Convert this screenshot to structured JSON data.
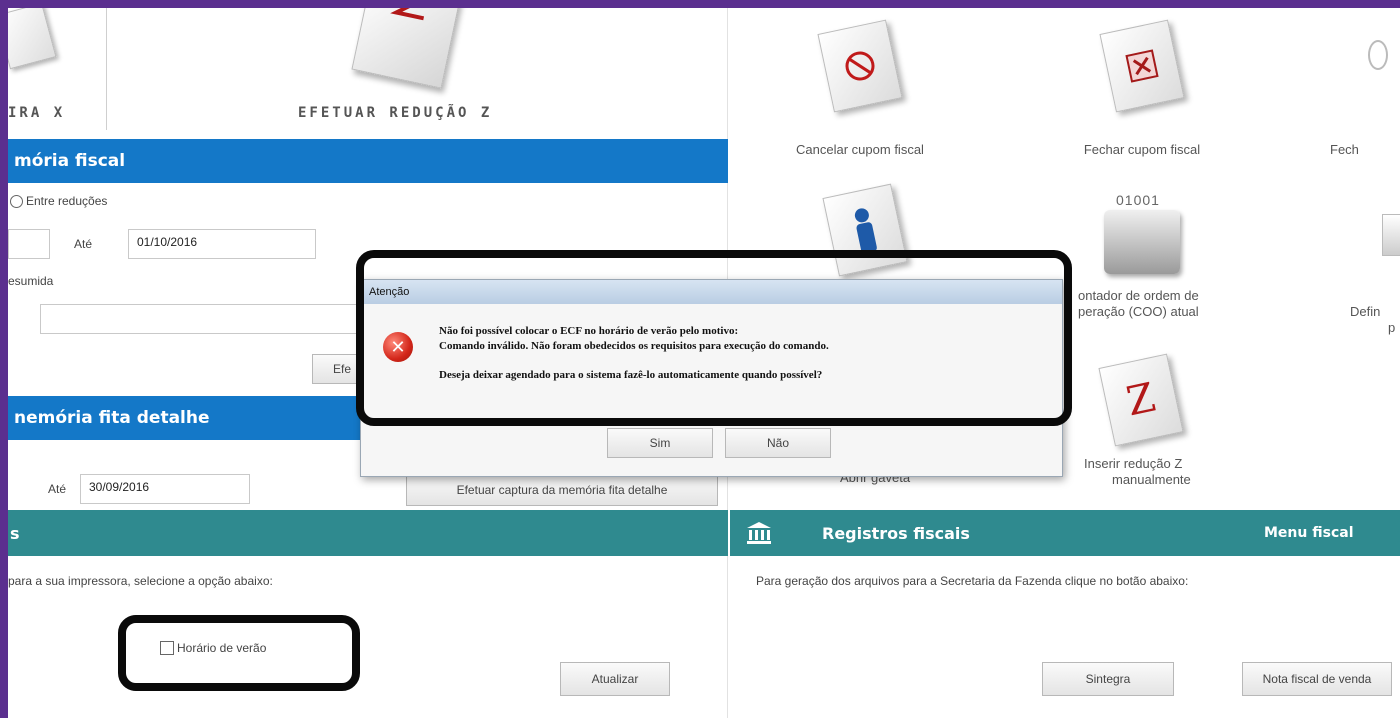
{
  "left": {
    "leitura_x_label": "IRA X",
    "reducao_z_label": "EFETUAR REDUÇÃO Z",
    "memoria_fiscal": {
      "header": "mória fiscal",
      "radio_label": "Entre reduções",
      "ate_label": "Até",
      "ate_value": "01/10/2016",
      "resumida_label": "esumida",
      "button_label": "Efe"
    },
    "memoria_fita": {
      "header": "nemória fita detalhe",
      "ate_label": "Até",
      "ate_value": "30/09/2016",
      "button_label": "Efetuar captura da memória fita detalhe"
    },
    "impressora": {
      "header": "s",
      "description": "para a sua impressora, selecione a opção abaixo:",
      "checkbox_label": "Horário de verão",
      "update_button": "Atualizar"
    }
  },
  "right": {
    "cards": [
      {
        "label": "Cancelar cupom fiscal",
        "icon": "cancel-icon"
      },
      {
        "label": "Fechar cupom fiscal",
        "icon": "close-receipt-icon"
      },
      {
        "label": "Fech",
        "icon": "partial-icon"
      }
    ],
    "row2": {
      "coo_number": "01001",
      "coo_label_line1": "ontador de ordem de",
      "coo_label_line2": "peração (COO) atual",
      "right_label_line1": "Defin",
      "right_label_line2": "p"
    },
    "row3": {
      "z_glyph": "Z",
      "z_label_line1": "Inserir redução Z",
      "z_label_line2": "manualmente",
      "gaveta_label": "Abrir gaveta"
    },
    "registros": {
      "header": "Registros fiscais",
      "menu_label": "Menu fiscal",
      "description": "Para geração dos arquivos para a Secretaria da Fazenda clique no botão abaixo:",
      "sintegra_button": "Sintegra",
      "nota_button": "Nota fiscal de venda"
    }
  },
  "dialog": {
    "title": "Atenção",
    "line1": "Não foi possível colocar o ECF no horário de verão pelo motivo:",
    "line2": "Comando inválido. Não foram obedecidos os requisitos para execução do comando.",
    "line3": "Deseja deixar agendado para o sistema fazê-lo automaticamente quando possível?",
    "yes_button": "Sim",
    "no_button": "Não"
  },
  "colors": {
    "blue_header": "#1478c8",
    "teal_header": "#2f8a8f",
    "frame": "#5b2f8f",
    "highlight": "#0a0a0a"
  }
}
